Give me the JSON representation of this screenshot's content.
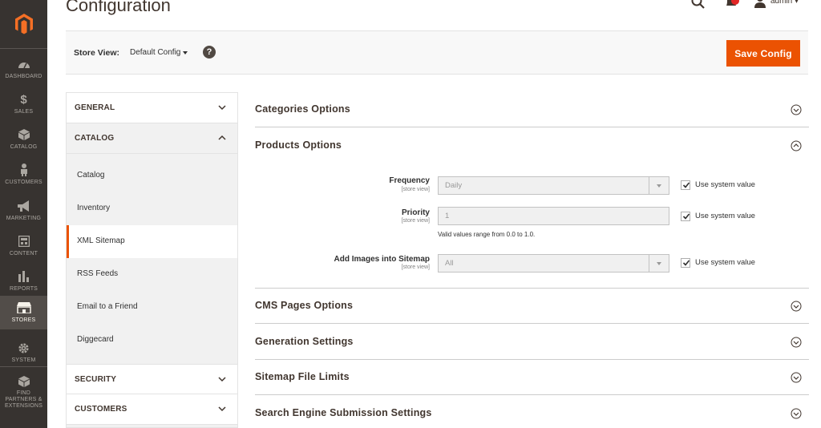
{
  "nav": {
    "items": [
      {
        "label": "DASHBOARD",
        "icon": "dashboard-icon"
      },
      {
        "label": "SALES",
        "icon": "dollar-icon"
      },
      {
        "label": "CATALOG",
        "icon": "cube-icon"
      },
      {
        "label": "CUSTOMERS",
        "icon": "person-icon"
      },
      {
        "label": "MARKETING",
        "icon": "megaphone-icon"
      },
      {
        "label": "CONTENT",
        "icon": "layout-icon"
      },
      {
        "label": "REPORTS",
        "icon": "bar-chart-icon"
      },
      {
        "label": "STORES",
        "icon": "storefront-icon"
      },
      {
        "label": "SYSTEM",
        "icon": "gear-icon"
      },
      {
        "label": "FIND PARTNERS & EXTENSIONS",
        "icon": "box-icon"
      }
    ],
    "active": "STORES"
  },
  "header": {
    "title": "Configuration",
    "user": "admin",
    "notification_color": "#e22626"
  },
  "store_bar": {
    "label": "Store View:",
    "value": "Default Config",
    "help": "?",
    "save_label": "Save Config"
  },
  "sidebar": {
    "general": "GENERAL",
    "catalog": "CATALOG",
    "catalog_items": [
      "Catalog",
      "Inventory",
      "XML Sitemap",
      "RSS Feeds",
      "Email to a Friend",
      "Diggecard"
    ],
    "active_item": "XML Sitemap",
    "security": "SECURITY",
    "customers": "CUSTOMERS"
  },
  "sections": {
    "categories": "Categories Options",
    "products": "Products Options",
    "cms": "CMS Pages Options",
    "generation": "Generation Settings",
    "limits": "Sitemap File Limits",
    "search_engine": "Search Engine Submission Settings"
  },
  "products_fields": {
    "frequency": {
      "label": "Frequency",
      "scope": "[store view]",
      "value": "Daily",
      "use_system": "Use system value"
    },
    "priority": {
      "label": "Priority",
      "scope": "[store view]",
      "value": "1",
      "note": "Valid values range from 0.0 to 1.0.",
      "use_system": "Use system value"
    },
    "images": {
      "label": "Add Images into Sitemap",
      "scope": "[store view]",
      "value": "All",
      "use_system": "Use system value"
    }
  },
  "colors": {
    "accent": "#eb5202",
    "nav_bg": "#373330"
  }
}
